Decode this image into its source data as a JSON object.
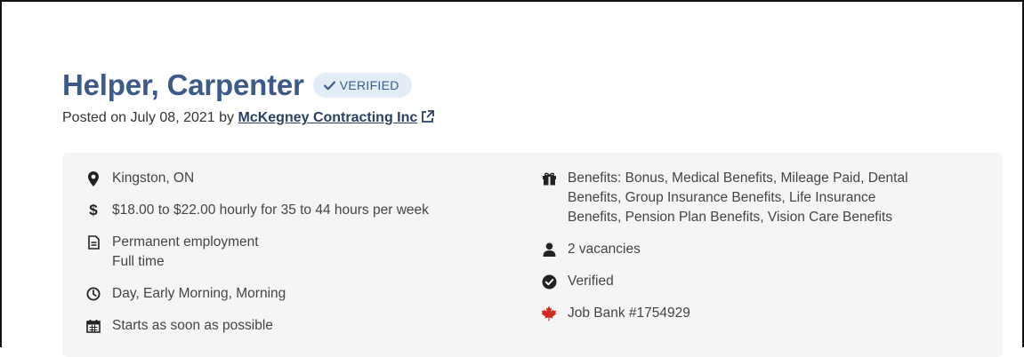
{
  "job": {
    "title": "Helper, Carpenter",
    "badge": "VERIFIED",
    "posted_prefix": "Posted on July 08, 2021 by",
    "employer": "McKegney Contracting Inc"
  },
  "details": {
    "location": "Kingston, ON",
    "salary": "$18.00 to $22.00 hourly for 35 to 44 hours per week",
    "employment_line1": "Permanent employment",
    "employment_line2": "Full time",
    "schedule": "Day, Early Morning, Morning",
    "start": "Starts as soon as possible",
    "benefits_line1": "Benefits: Bonus, Medical Benefits, Mileage Paid, Dental",
    "benefits_line2": "Benefits, Group Insurance Benefits, Life Insurance",
    "benefits_line3": "Benefits, Pension Plan Benefits, Vision Care Benefits",
    "vacancies": "2 vacancies",
    "verified": "Verified",
    "job_bank": "Job Bank #1754929"
  },
  "icons": {
    "location": "map-marker-icon",
    "salary": "dollar-icon",
    "employment": "document-icon",
    "schedule": "clock-icon",
    "start": "calendar-icon",
    "benefits": "gift-icon",
    "vacancies": "person-icon",
    "verified": "check-circle-icon",
    "job_bank": "maple-leaf-icon",
    "employer_link": "external-link-icon",
    "badge": "checkmark-icon"
  },
  "colors": {
    "title": "#3c5a8a",
    "badge_bg": "#e3edf7",
    "card_bg": "#f5f5f5",
    "maple": "#d52b1e"
  }
}
